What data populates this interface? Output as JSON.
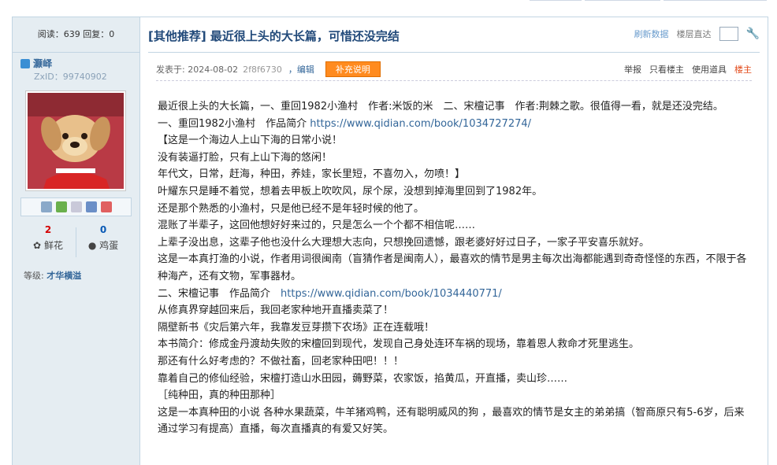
{
  "stats": {
    "views_label": "阅读：",
    "views": "639",
    "replies_label": " 回复：",
    "replies": "0"
  },
  "user": {
    "name": "灏峄",
    "zxid": "ZxID：99740902",
    "level_label": "等级:",
    "level": "才华横溢"
  },
  "counters": [
    {
      "value": "2",
      "label": "鲜花"
    },
    {
      "value": "0",
      "label": "鸡蛋"
    }
  ],
  "thread": {
    "title": "[其他推荐] 最近很上头的大长篇，可惜还没完结",
    "refresh": "刷新数据",
    "floor_jump": "楼层直达"
  },
  "post": {
    "posted": "发表于: 2024-08-02",
    "pid": "2f8f6730",
    "edit": "，编辑",
    "supplement": "补充说明",
    "report": "举报",
    "only_owner": "只看楼主",
    "use_tool": "使用道具",
    "owner": "楼主"
  },
  "content": {
    "l1": "最近很上头的大长篇，一、重回1982小渔村　作者:米饭的米　二、宋檀记事　作者:荆棘之歌。很值得一看，就是还没完结。",
    "l2a": "一、重回1982小渔村　作品简介 ",
    "l2b": "https://www.qidian.com/book/1034727274/",
    "l3": "【这是一个海边人上山下海的日常小说！",
    "l4": "没有装逼打脸，只有上山下海的悠闲！",
    "l5": "年代文，日常，赶海，种田，养娃，家长里短，不喜勿入，勿喷！】",
    "l6": "叶耀东只是睡不着觉，想着去甲板上吹吹风，尿个尿，没想到掉海里回到了1982年。",
    "l7": "还是那个熟悉的小渔村，只是他已经不是年轻时候的他了。",
    "l8": "混账了半辈子，这回他想好好来过的，只是怎么一个个都不相信呢……",
    "l9": "上辈子没出息，这辈子他也没什么大理想大志向，只想挽回遗憾，跟老婆好好过日子，一家子平安喜乐就好。",
    "l10": "这是一本真打渔的小说，作者用词很闽南（盲猜作者是闽南人），最喜欢的情节是男主每次出海都能遇到奇奇怪怪的东西，不限于各种海产，还有文物，军事器材。",
    "l11a": "二、宋檀记事　作品简介　",
    "l11b": "https://www.qidian.com/book/1034440771/",
    "l12": "从修真界穿越回来后，我回老家种地开直播卖菜了！",
    "l13": "隔壁新书《灾后第六年，我靠发豆芽攒下农场》正在连载哦！",
    "l14": "本书简介：修成金丹渡劫失败的宋檀回到现代，发现自己身处连环车祸的现场，靠着恩人救命才死里逃生。",
    "l15": "那还有什么好考虑的？不做社畜，回老家种田吧！！！",
    "l16": "靠着自己的修仙经验，宋檀打造山水田园，薅野菜，农家饭，掐黄瓜，开直播，卖山珍……",
    "l17": "［纯种田，真的种田那种］",
    "l18": "这是一本真种田的小说 各种水果蔬菜，牛羊猪鸡鸭，还有聪明威风的狗 ，最喜欢的情节是女主的弟弟搞（智商原只有5-6岁，后来通过学习有提高）直播，每次直播真的有爱又好笑。"
  },
  "colors": {
    "sidebar_bg": "#e5edf2",
    "border": "#c2d5e3",
    "title": "#224a7a",
    "link": "#336699",
    "supplement": "#ff8b1f",
    "owner": "#e24a1a"
  }
}
